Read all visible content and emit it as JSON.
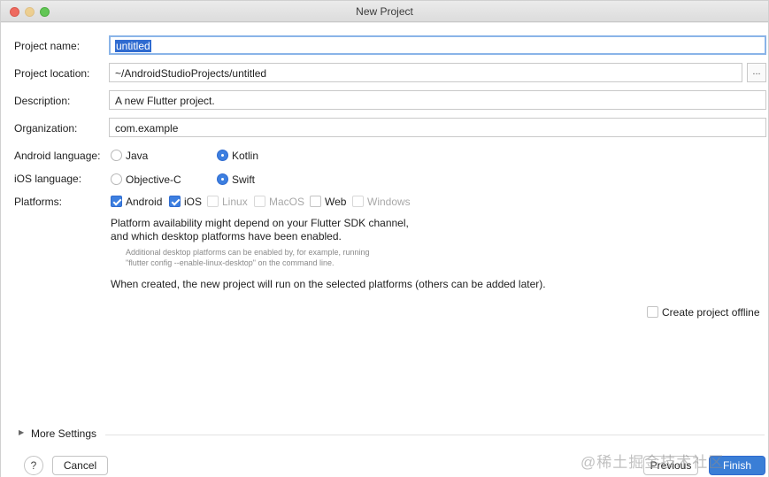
{
  "window": {
    "title": "New Project"
  },
  "form": {
    "project_name": {
      "label": "Project name:",
      "value": "untitled"
    },
    "project_location": {
      "label": "Project location:",
      "value": "~/AndroidStudioProjects/untitled",
      "browse_label": "..."
    },
    "description": {
      "label": "Description:",
      "value": "A new Flutter project."
    },
    "organization": {
      "label": "Organization:",
      "value": "com.example"
    },
    "android_language": {
      "label": "Android language:",
      "options": [
        "Java",
        "Kotlin"
      ],
      "selected": "Kotlin"
    },
    "ios_language": {
      "label": "iOS language:",
      "options": [
        "Objective-C",
        "Swift"
      ],
      "selected": "Swift"
    },
    "platforms": {
      "label": "Platforms:",
      "items": [
        {
          "label": "Android",
          "checked": true,
          "enabled": true
        },
        {
          "label": "iOS",
          "checked": true,
          "enabled": true
        },
        {
          "label": "Linux",
          "checked": false,
          "enabled": false
        },
        {
          "label": "MacOS",
          "checked": false,
          "enabled": false
        },
        {
          "label": "Web",
          "checked": false,
          "enabled": true
        },
        {
          "label": "Windows",
          "checked": false,
          "enabled": false
        }
      ]
    },
    "notes": {
      "availability_line1": "Platform availability might depend on your Flutter SDK channel,",
      "availability_line2": "and which desktop platforms have been enabled.",
      "hint_line1": "Additional desktop platforms can be enabled by, for example, running",
      "hint_line2": "\"flutter config --enable-linux-desktop\" on the command line.",
      "run_note": "When created, the new project will run on the selected platforms (others can be added later)."
    },
    "create_offline": {
      "label": "Create project offline",
      "checked": false
    }
  },
  "more_settings": {
    "label": "More Settings"
  },
  "footer": {
    "help_label": "?",
    "cancel_label": "Cancel",
    "previous_label": "Previous",
    "finish_label": "Finish"
  },
  "watermark": "@稀土掘金技术社区"
}
